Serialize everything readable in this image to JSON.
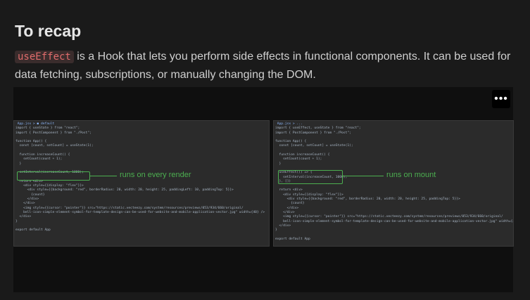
{
  "heading": "To recap",
  "paragraph": {
    "code": "useEffect",
    "text": " is a Hook that lets you perform side effects in functional components. It can be used for data fetching, subscriptions, or manually changing the DOM."
  },
  "media": {
    "more_label": "•••",
    "left": {
      "tab": " App.jsx > ◼ default",
      "annotation": "runs on every render",
      "code": "import { useState } from \"react\";\nimport { PostComponent } from \"./Post\";\n\nfunction App() {\n  const [count, setCount] = useState(1);\n\n  function increaseCount() {\n    setCount(count + 1);\n  }\n\n  setInterval(increaseCount, 1000);\n\n  return <div>\n    <div style={{display: \"flex\"}}>\n      <div style={{background: \"red\", borderRadius: 20, width: 20, height: 25, paddingLeft: 10, paddingTop: 5}}>\n        {count}\n      </div>\n    </div>\n    <img style={{cursor: \"pointer\"}} src=\"https://static.vecteezy.com/system/resources/previews/053/934/660/original/\n    bell-icon-simple-element-symbol-for-template-design-can-be-used-for-website-and-mobile-application-vector.jpg\" width={40} />\n  </div>\n}\n\nexport default App"
    },
    "right": {
      "tab": " App.jsx > ...",
      "annotation": "runs on mount",
      "code": "import { useEffect, useState } from \"react\";\nimport { PostComponent } from \"./Post\";\n\nfunction App() {\n  const [count, setCount] = useState(1);\n\n  function increaseCount() {\n    setCount(count + 1);\n  }\n\n  useEffect(() => {\n    setInterval(increaseCount, 1000);\n  }, [])\n\n  return <div>\n    <div style={{display: \"flex\"}}>\n      <div style={{background: \"red\", borderRadius: 20, width: 20, height: 25, paddingTop: 5}}>\n        {count}\n      </div>\n    </div>\n    <img style={{cursor: \"pointer\"}} src=\"https://static.vecteezy.com/system/resources/previews/053/934/660/original/\n    bell-icon-simple-element-symbol-for-template-design-can-be-used-for-website-and-mobile-application-vector.jpg\" width={40} />\n  </div>\n}\n\nexport default App"
    }
  },
  "colors": {
    "accent_green": "#4caf50",
    "inline_code": "#e06c6c",
    "background": "#1a1a1a"
  }
}
